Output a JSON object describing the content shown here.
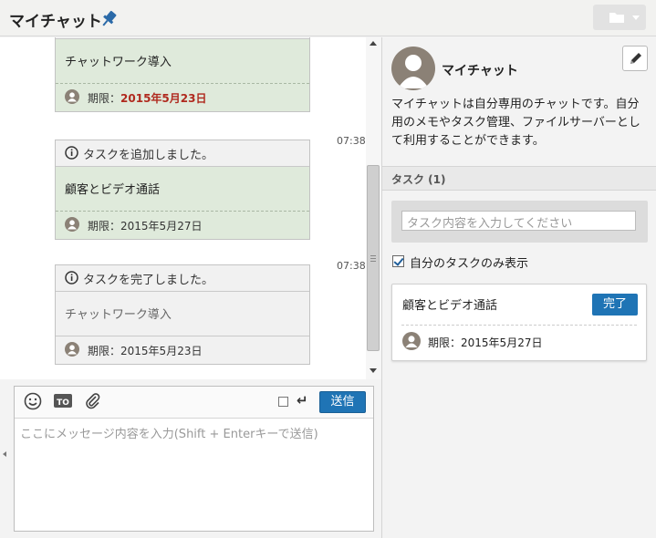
{
  "header": {
    "title": "マイチャット",
    "pin_icon": "pin-icon",
    "folder_icon": "folder-icon"
  },
  "timeline": {
    "cards": [
      {
        "status": "added",
        "head": "",
        "task": "チャットワーク導入",
        "due_label": "期限：",
        "due": "2015年5月23日",
        "overdue": true,
        "time": ""
      },
      {
        "status": "added",
        "head": "タスクを追加しました。",
        "task": "顧客とビデオ通話",
        "due_label": "期限：",
        "due": "2015年5月27日",
        "overdue": false,
        "time": "07:38"
      },
      {
        "status": "done",
        "head": "タスクを完了しました。",
        "task": "チャットワーク導入",
        "due_label": "期限：",
        "due": "2015年5月23日",
        "overdue": false,
        "time": "07:38"
      }
    ]
  },
  "composer": {
    "emoji_icon": "smiley-icon",
    "to_icon": "to-icon",
    "attach_icon": "paperclip-icon",
    "enter_icon": "enter-icon",
    "send_label": "送信",
    "placeholder": "ここにメッセージ内容を入力(Shift + Enterキーで送信)"
  },
  "side": {
    "profile_name": "マイチャット",
    "edit_icon": "pencil-icon",
    "description": "マイチャットは自分専用のチャットです。自分用のメモやタスク管理、ファイルサーバーとして利用することができます。",
    "task_title": "タスク (1)",
    "task_input_placeholder": "タスク内容を入力してください",
    "mine_only_label": "自分のタスクのみ表示",
    "mine_only_checked": true,
    "tasks": [
      {
        "text": "顧客とビデオ通話",
        "complete_label": "完了",
        "due_label": "期限：",
        "due": "2015年5月27日"
      }
    ]
  },
  "colors": {
    "accent": "#1f74b5",
    "task_green": "#dfeadb",
    "overdue_red": "#b0291e"
  }
}
